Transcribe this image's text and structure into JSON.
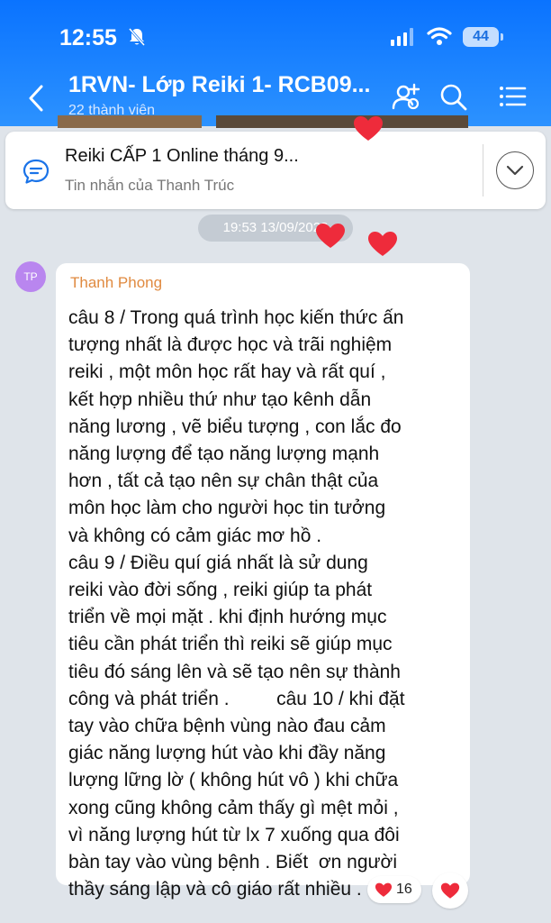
{
  "status_bar": {
    "time": "12:55",
    "battery": "44"
  },
  "header": {
    "title": "1RVN- Lớp Reiki 1- RCB09...",
    "subtitle": "22 thành viên"
  },
  "pinned": {
    "title": "Reiki CẤP 1 Online tháng 9...",
    "subtitle": "Tin nhắn của Thanh Trúc"
  },
  "date_pill": "19:53 13/09/2023",
  "message": {
    "avatar_initials": "TP",
    "avatar_color": "#b986ef",
    "sender": "Thanh Phong",
    "text": "câu 8 / Trong quá trình học kiến thức ấn\ntượng nhất là được học và trãi nghiệm\nreiki , một môn học rất hay và rất quí ,\nkết hợp nhiều thứ như tạo kênh dẫn\nnăng lương , vẽ biểu tượng , con lắc đo\nnăng lượng để tạo năng lượng mạnh\nhơn , tất cả tạo nên sự chân thật của\nmôn học làm cho người học tin tưởng\nvà không có cảm giác mơ hồ .\ncâu 9 / Điều quí giá nhất là sử dung\nreiki vào đời sống , reiki giúp ta phát\ntriển về mọi mặt . khi định hướng mục\ntiêu cần phát triển thì reiki sẽ giúp mục\ntiêu đó sáng lên và sẽ tạo nên sự thành\ncông và phát triển .         câu 10 / khi đặt\ntay vào chữa bệnh vùng nào đau cảm\ngiác năng lượng hút vào khi đầy năng\nlượng lững lờ ( không hút vô ) khi chữa\nxong cũng không cảm thấy gì mệt mỏi ,\nvì năng lượng hút từ lx 7 xuống qua đôi\nbàn tay vào vùng bệnh . Biết  ơn người\nthầy sáng lập và cô giáo rất nhiều .",
    "reaction_count": "16"
  },
  "colors": {
    "header_blue": "#0a73ff",
    "heart_red": "#ee2b3b",
    "sender_orange": "#e08a40"
  },
  "icons": [
    "bell-off-icon",
    "signal-icon",
    "wifi-icon",
    "battery-icon",
    "back-icon",
    "add-member-icon",
    "search-icon",
    "menu-list-icon",
    "chat-bubble-icon",
    "chevron-down-icon",
    "heart-icon"
  ]
}
